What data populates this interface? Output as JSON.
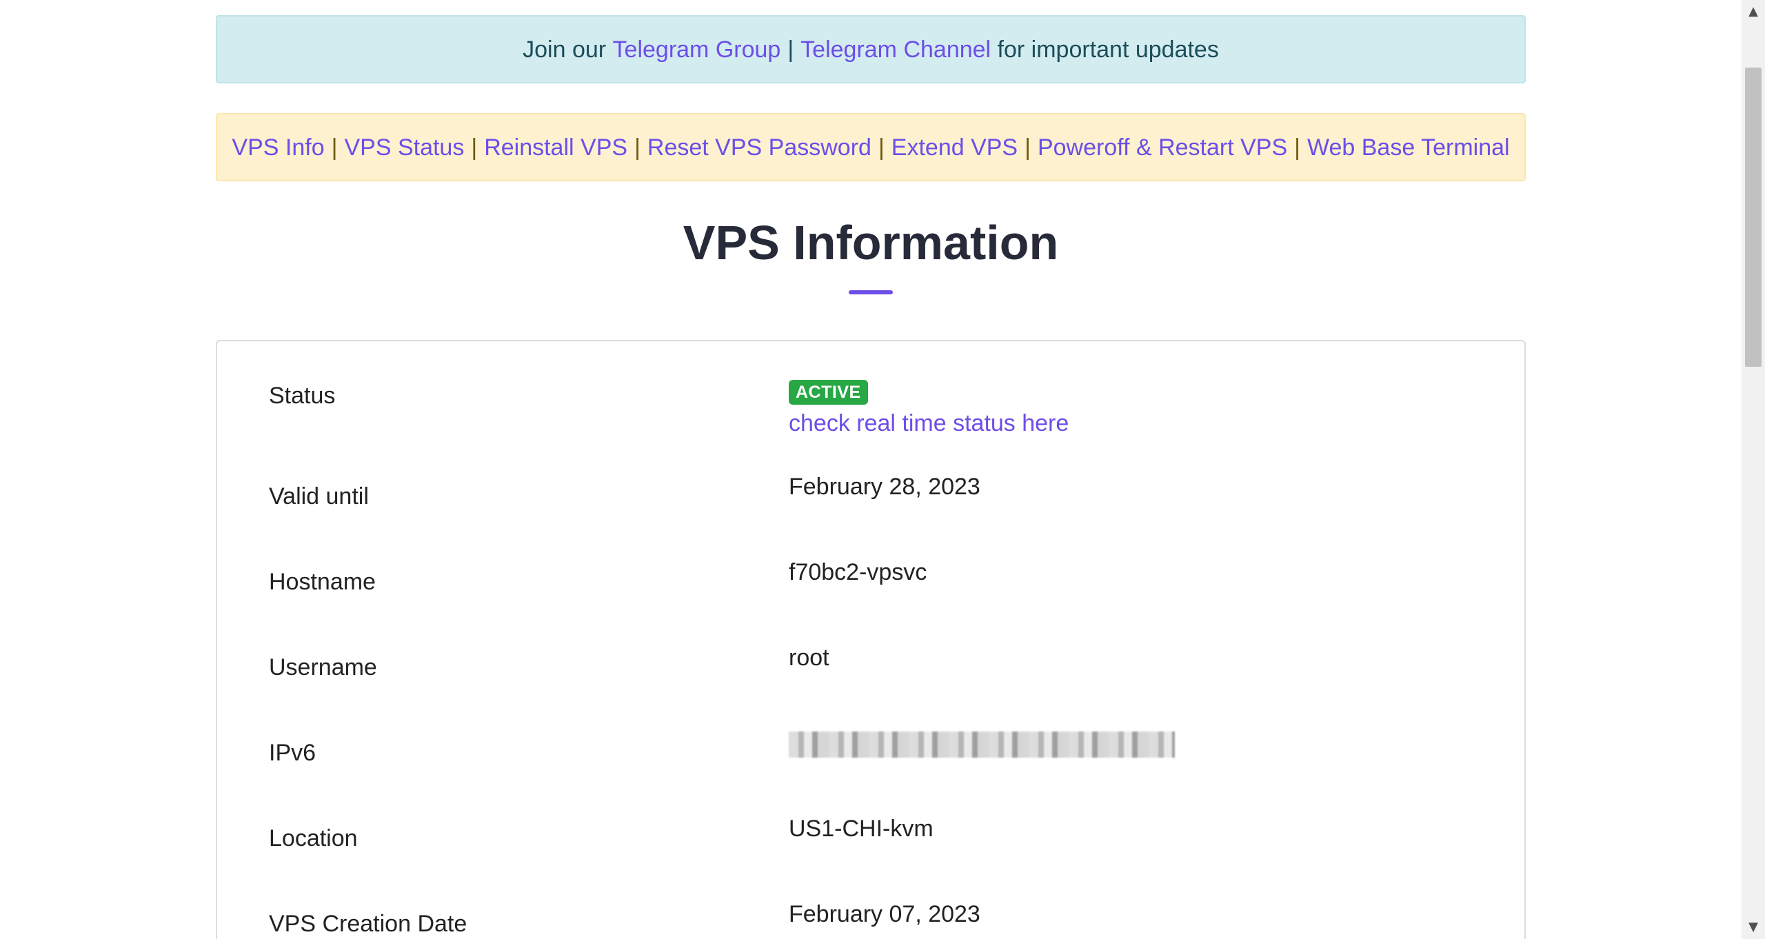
{
  "telegram_banner": {
    "prefix": "Join our ",
    "group_link": "Telegram Group",
    "separator": "|",
    "channel_link": "Telegram Channel",
    "suffix": " for important updates"
  },
  "nav_banner": {
    "links": [
      "VPS Info",
      "VPS Status",
      "Reinstall VPS",
      "Reset VPS Password",
      "Extend VPS",
      "Poweroff & Restart VPS",
      "Web Base Terminal"
    ],
    "separator": "|"
  },
  "page_title": "VPS Information",
  "info": {
    "status": {
      "label": "Status",
      "badge": "ACTIVE",
      "link": "check real time status here"
    },
    "valid_until": {
      "label": "Valid until",
      "value": "February 28, 2023"
    },
    "hostname": {
      "label": "Hostname",
      "value": "f70bc2-vpsvc"
    },
    "username": {
      "label": "Username",
      "value": "root"
    },
    "ipv6": {
      "label": "IPv6"
    },
    "location": {
      "label": "Location",
      "value": "US1-CHI-kvm"
    },
    "creation_date": {
      "label": "VPS Creation Date",
      "value": "February 07, 2023"
    }
  },
  "colors": {
    "link": "#6c4ee8",
    "badge_active": "#28a745",
    "info_banner_bg": "#d3ecf0",
    "warning_banner_bg": "#fdf1cf"
  },
  "scrollbar": {
    "up_icon": "triangle-up-icon",
    "down_icon": "triangle-down-icon"
  }
}
